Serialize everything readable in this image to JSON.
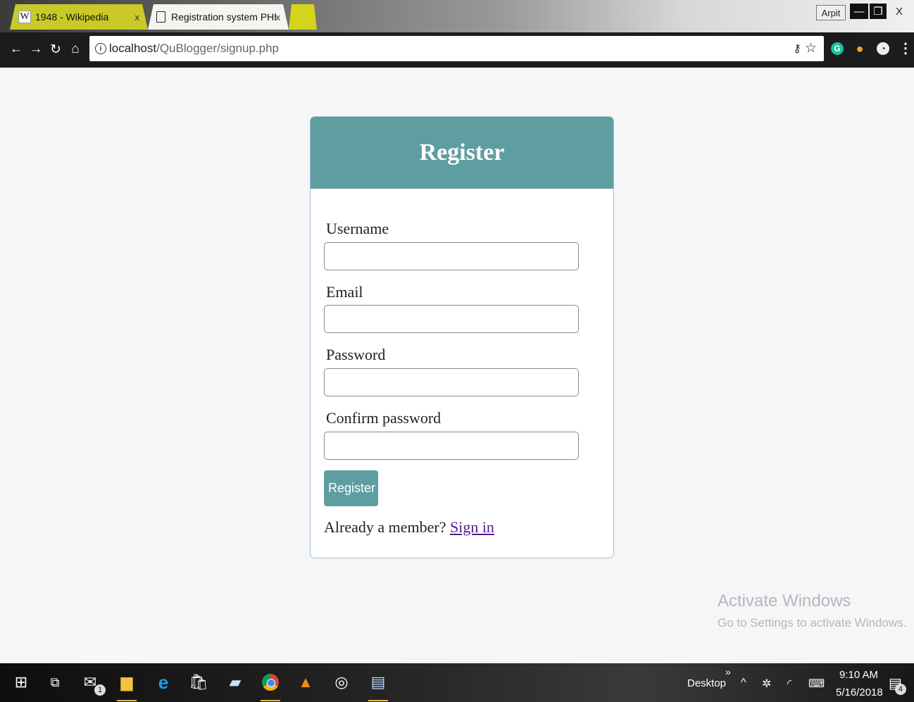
{
  "browser": {
    "tabs": [
      {
        "favicon": "W",
        "title": "1948 - Wikipedia",
        "close": "x"
      },
      {
        "title": "Registration system PHP",
        "close": "x"
      }
    ],
    "user": "Arpit",
    "url_host": "localhost",
    "url_path": "/QuBlogger/signup.php"
  },
  "page": {
    "title": "Register",
    "fields": {
      "username": "Username",
      "email": "Email",
      "password": "Password",
      "confirm": "Confirm password"
    },
    "submit_label": "Register",
    "member_text": "Already a member? ",
    "signin_label": "Sign in"
  },
  "watermark": {
    "title": "Activate Windows",
    "subtitle": "Go to Settings to activate Windows."
  },
  "taskbar": {
    "mail_badge": "1",
    "desktop_label": "Desktop",
    "chevron": "»",
    "time": "9:10 AM",
    "date": "5/16/2018",
    "notification_count": "4"
  },
  "colors": {
    "accent": "#5f9ea0",
    "link": "#551a8b"
  }
}
